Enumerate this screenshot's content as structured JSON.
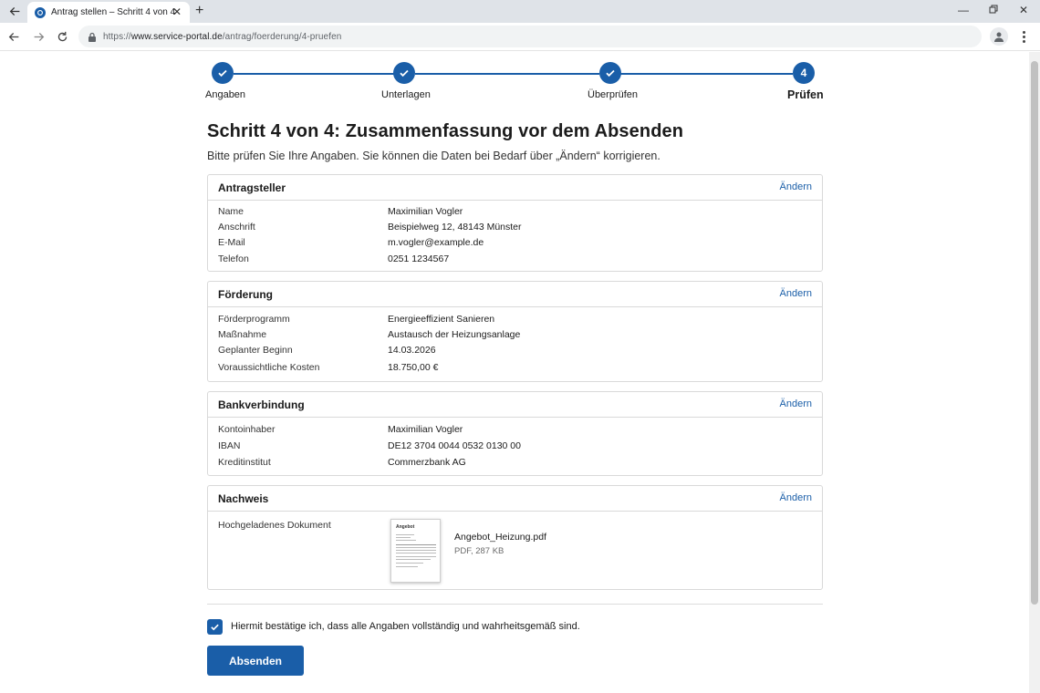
{
  "browser": {
    "tab_title": "Antrag stellen – Schritt 4 von 4",
    "url_scheme": "https://",
    "url_host": "www.service-portal.de",
    "url_path": "/antrag/foerderung/4-pruefen"
  },
  "stepper": {
    "steps": [
      {
        "label": "Angaben",
        "state": "done"
      },
      {
        "label": "Unterlagen",
        "state": "done"
      },
      {
        "label": "Überprüfen",
        "state": "done"
      },
      {
        "label": "Prüfen",
        "number": "4",
        "state": "active"
      }
    ]
  },
  "page": {
    "title": "Schritt 4 von 4: Zusammenfassung vor dem Absenden",
    "subtitle": "Bitte prüfen Sie Ihre Angaben. Sie können die Daten bei Bedarf über „Ändern“ korrigieren."
  },
  "sections": {
    "applicant": {
      "title": "Antragsteller",
      "edit_label": "Ändern",
      "rows": [
        {
          "label": "Name",
          "value": "Maximilian Vogler"
        },
        {
          "label": "Anschrift",
          "value": "Beispielweg 12, 48143 Münster"
        },
        {
          "label": "E-Mail",
          "value": "m.vogler@example.de"
        },
        {
          "label": "Telefon",
          "value": "0251 1234567"
        }
      ]
    },
    "funding": {
      "title": "Förderung",
      "edit_label": "Ändern",
      "rows": [
        {
          "label": "Förderprogramm",
          "value": "Energieeffizient Sanieren"
        },
        {
          "label": "Maßnahme",
          "value": "Austausch der Heizungsanlage"
        },
        {
          "label": "Geplanter Beginn",
          "value": "14.03.2026"
        },
        {
          "label": "Voraussichtliche Kosten",
          "value": "18.750,00 €"
        }
      ]
    },
    "bank": {
      "title": "Bankverbindung",
      "edit_label": "Ändern",
      "rows": [
        {
          "label": "Kontoinhaber",
          "value": "Maximilian Vogler"
        },
        {
          "label": "IBAN",
          "value": "DE12 3704 0044 0532 0130 00"
        },
        {
          "label": "Kreditinstitut",
          "value": "Commerzbank AG"
        }
      ]
    },
    "proof": {
      "title": "Nachweis",
      "edit_label": "Ändern",
      "row_label": "Hochgeladenes Dokument",
      "document": {
        "thumb_title": "Angebot",
        "filename": "Angebot_Heizung.pdf",
        "meta": "PDF, 287 KB"
      }
    }
  },
  "confirmation": {
    "checked": true,
    "text": "Hiermit bestätige ich, dass alle Angaben vollständig und wahrheitsgemäß sind."
  },
  "submit_label": "Absenden",
  "colors": {
    "primary": "#1a5ea8",
    "border": "#d9d9d9"
  }
}
